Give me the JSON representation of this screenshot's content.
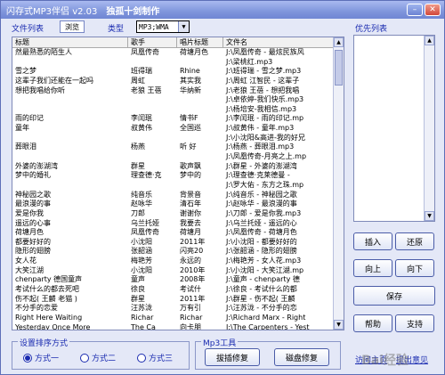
{
  "window": {
    "title": "闪存式MP3伴侣 v2.03",
    "credit": "独孤十剑制作",
    "min_glyph": "–",
    "close_glyph": "✕"
  },
  "top": {
    "file_list_label": "文件列表",
    "browse_label": "浏览",
    "type_label": "类型",
    "type_value": "MP3;WMA",
    "priority_label": "优先列表"
  },
  "table": {
    "columns": [
      "标题",
      "歌手",
      "唱片标题",
      "文件名"
    ],
    "rows": [
      [
        "然最熟悉的陌生人",
        "凤凰传奇",
        "荷塘月色",
        "J:\\凤凰传奇 - 最炫民族风"
      ],
      [
        "",
        "",
        "",
        "J:\\梁桃红.mp3"
      ],
      [
        "雪之梦",
        "班得瑞",
        "Rhine",
        "J:\\班得瑞 - 雪之梦.mp3"
      ],
      [
        "这辈子我们还能在一起吗",
        "周虹",
        "其实我",
        "J:\\周虹 江智民 - 这辈子"
      ],
      [
        "想把我唱给你听",
        "老狼 王蓓",
        "华纳新",
        "J:\\老狼 王蓓 - 想把我唱"
      ],
      [
        "",
        "",
        "",
        "J:\\卓依婷-我们快乐.mp3"
      ],
      [
        "",
        "",
        "",
        "J:\\杨培安-我相信.mp3"
      ],
      [
        "雨的印记",
        "李闰珉",
        "情书F",
        "J:\\李闰珉 - 雨的印记.mp"
      ],
      [
        "童年",
        "叔黄伟",
        "全国巡",
        "J:\\叔黄伟 - 童年.mp3"
      ],
      [
        "",
        "",
        "",
        "J:\\小沈阳&高进-我的好兄"
      ],
      [
        "葬眼泪",
        "杨燕",
        "听 好",
        "J:\\杨燕 - 葬眼泪.mp3"
      ],
      [
        "",
        "",
        "",
        "J:\\凤凰传奇-月亮之上.mp"
      ],
      [
        "外婆的澎湖湾",
        "群星",
        "歌声飘",
        "J:\\群星 - 外婆的澎湖湾"
      ],
      [
        "梦中的婚礼",
        "理查德·克",
        "梦中的",
        "J:\\理查德·克莱德曼 -"
      ],
      [
        "",
        "",
        "",
        "J:\\罗大佑 - 东方之珠.mp"
      ],
      [
        "神秘园之歌",
        "纯音乐",
        "背景音",
        "J:\\纯音乐 - 神秘园之歌"
      ],
      [
        "最浪漫的事",
        "赵咏华",
        "清石年",
        "J:\\赵咏华 - 最浪漫的事"
      ],
      [
        "爱是你我",
        "刀郎",
        "谢谢你",
        "J:\\刀郎 - 爱是你我.mp3"
      ],
      [
        "遥远的心事",
        "乌兰托娅",
        "我要去",
        "J:\\乌兰托娅 - 遥远的心"
      ],
      [
        "荷塘月色",
        "凤凰传奇",
        "荷塘月",
        "J:\\凤凰传奇 - 荷塘月色"
      ],
      [
        "都要好好的",
        "小沈阳",
        "2011年",
        "J:\\小沈阳 - 都要好好的"
      ],
      [
        "隐形的翅膀",
        "张韶涵",
        "闪亮20",
        "J:\\张韶涵 - 隐形的翅膀"
      ],
      [
        "女人花",
        "梅艳芳",
        "永远的",
        "J:\\梅艳芳 - 女人花.mp3"
      ],
      [
        "大笑江湖",
        "小沈阳",
        "2010年",
        "J:\\小沈阳 - 大笑江湖.mp"
      ],
      [
        "chenparty 德国童声",
        "童声",
        "2008年",
        "J:\\童声 - chenparty 德"
      ],
      [
        "考试什么的都去死吧",
        "徐良",
        "考试什",
        "J:\\徐良 - 考试什么的都"
      ],
      [
        "伤不起( 王麟 老猫 )",
        "群星",
        "2011年",
        "J:\\群星 - 伤不起( 王麟"
      ],
      [
        "不分手的恋爱",
        "汪苏泷",
        "万有引",
        "J:\\汪苏泷 - 不分手的恋"
      ],
      [
        "Right Here Waiting",
        "Richar",
        "Richar",
        "J:\\Richard Marx - Right"
      ],
      [
        "Yesterday Once More",
        "The Ca",
        "向卡朋",
        "J:\\The Carpenters - Yest"
      ]
    ],
    "selected_row": 30
  },
  "buttons": {
    "insert": "插入",
    "restore": "还原",
    "up": "向上",
    "down": "向下",
    "save": "保存",
    "help": "帮助",
    "support": "支持"
  },
  "sort": {
    "title": "设置排序方式",
    "options": [
      "方式一",
      "方式二",
      "方式三"
    ],
    "selected": 0
  },
  "mp3_tools": {
    "title": "Mp3工具",
    "fix_button": "拔插修复",
    "disk_fix_button": "磁盘修复"
  },
  "links": {
    "homepage": "访问主页",
    "feedback": "提出意见"
  },
  "watermark": "Bai经验"
}
